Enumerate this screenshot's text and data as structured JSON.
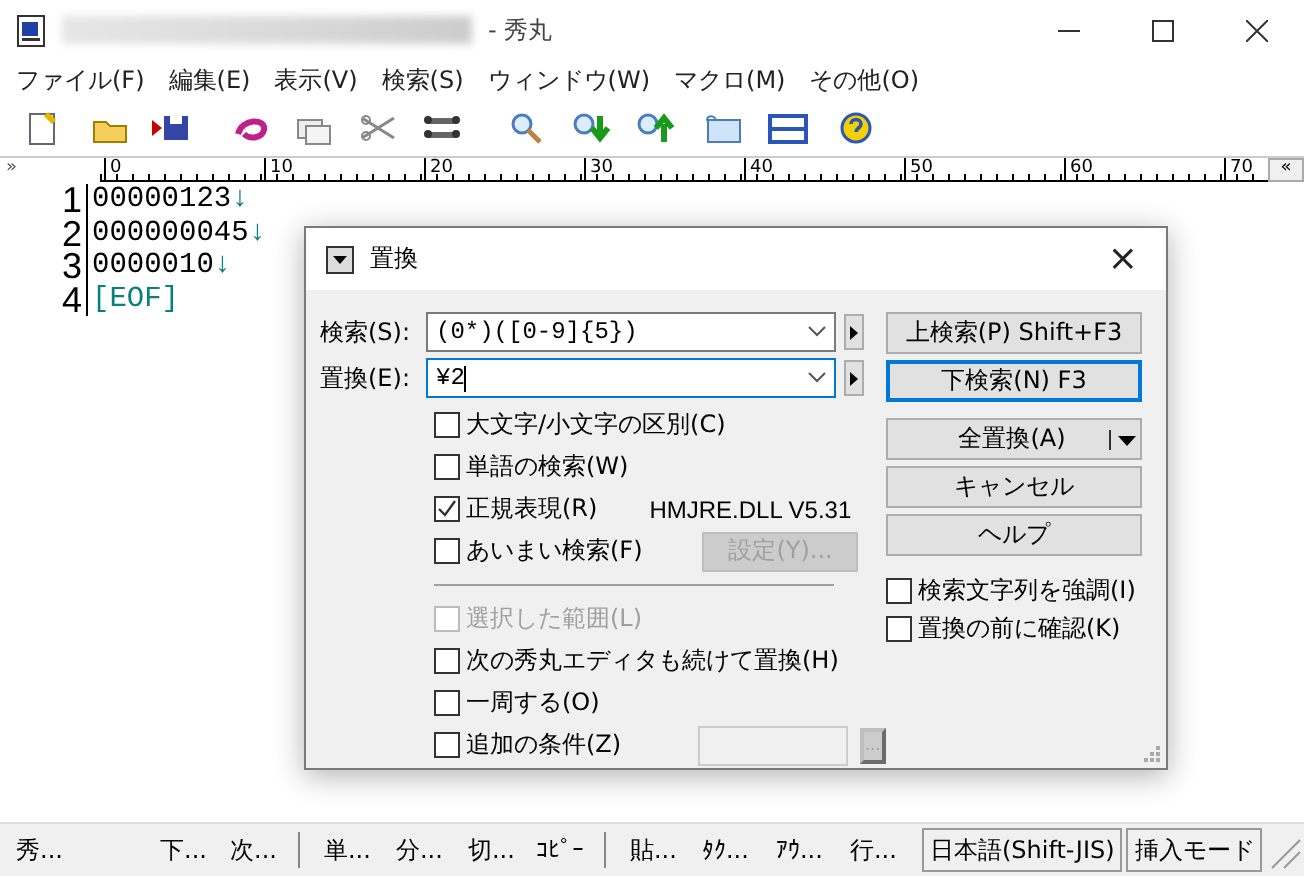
{
  "window": {
    "title": "- 秀丸",
    "title_hidden": true
  },
  "menu": [
    "ファイル(F)",
    "編集(E)",
    "表示(V)",
    "検索(S)",
    "ウィンドウ(W)",
    "マクロ(M)",
    "その他(O)"
  ],
  "ruler": {
    "labels": [
      "0",
      "10",
      "20",
      "30",
      "40",
      "50",
      "60",
      "70"
    ],
    "left_mark": "»",
    "right_mark": "«"
  },
  "editor": {
    "lines": [
      {
        "number": "1",
        "text": "00000123",
        "eol": "↓",
        "kind": "text"
      },
      {
        "number": "2",
        "text": "000000045",
        "eol": "↓",
        "kind": "text"
      },
      {
        "number": "3",
        "text": "0000010",
        "eol": "↓",
        "kind": "text"
      },
      {
        "number": "4",
        "text": "[EOF]",
        "kind": "eof"
      }
    ]
  },
  "dialog": {
    "title": "置換",
    "close": "×",
    "fields": [
      {
        "label": "検索(S):",
        "value": "(0*)([0-9]{5})",
        "focused": false
      },
      {
        "label": "置換(E):",
        "value": "¥2",
        "focused": true
      }
    ],
    "buttons": [
      {
        "label": "上検索(P) Shift+F3",
        "focused": false,
        "kind": "plain"
      },
      {
        "label": "下検索(N) F3",
        "focused": true,
        "kind": "plain"
      },
      {
        "label": "全置換(A)",
        "focused": false,
        "kind": "split"
      },
      {
        "label": "キャンセル",
        "focused": false,
        "kind": "plain"
      },
      {
        "label": "ヘルプ",
        "focused": false,
        "kind": "plain"
      }
    ],
    "options": [
      {
        "label": "大文字/小文字の区別(C)",
        "checked": false,
        "disabled": false
      },
      {
        "label": "単語の検索(W)",
        "checked": false,
        "disabled": false
      },
      {
        "label": "正規表現(R)",
        "checked": true,
        "disabled": false,
        "note": "HMJRE.DLL V5.31"
      },
      {
        "label": "あいまい検索(F)",
        "checked": false,
        "disabled": false,
        "button": {
          "label": "設定(Y)...",
          "disabled": true
        }
      }
    ],
    "more_options": [
      {
        "label": "選択した範囲(L)",
        "checked": false,
        "disabled": true
      },
      {
        "label": "次の秀丸エディタも続けて置換(H)",
        "checked": false,
        "disabled": false
      },
      {
        "label": "一周する(O)",
        "checked": false,
        "disabled": false
      },
      {
        "label": "追加の条件(Z)",
        "checked": false,
        "disabled": false,
        "field": {
          "disabled": true
        },
        "button": {
          "label": "...",
          "disabled": true
        }
      }
    ],
    "side_options": [
      {
        "label": "検索文字列を強調(I)",
        "checked": false,
        "disabled": false
      },
      {
        "label": "置換の前に確認(K)",
        "checked": false,
        "disabled": false
      }
    ]
  },
  "status_bar": [
    {
      "kind": "text",
      "text": "秀..."
    },
    {
      "kind": "text",
      "text": "下..."
    },
    {
      "kind": "text",
      "text": "次..."
    },
    {
      "kind": "separator"
    },
    {
      "kind": "text",
      "text": "単..."
    },
    {
      "kind": "text",
      "text": "分..."
    },
    {
      "kind": "text",
      "text": "切..."
    },
    {
      "kind": "text",
      "text": "ｺﾋﾟｰ"
    },
    {
      "kind": "separator"
    },
    {
      "kind": "text",
      "text": "貼..."
    },
    {
      "kind": "text",
      "text": "ﾀｸ..."
    },
    {
      "kind": "text",
      "text": "ｱｳ..."
    },
    {
      "kind": "text",
      "text": "行..."
    },
    {
      "kind": "box",
      "text": "日本語(Shift-JIS)"
    },
    {
      "kind": "box",
      "text": "挿入モード"
    }
  ]
}
